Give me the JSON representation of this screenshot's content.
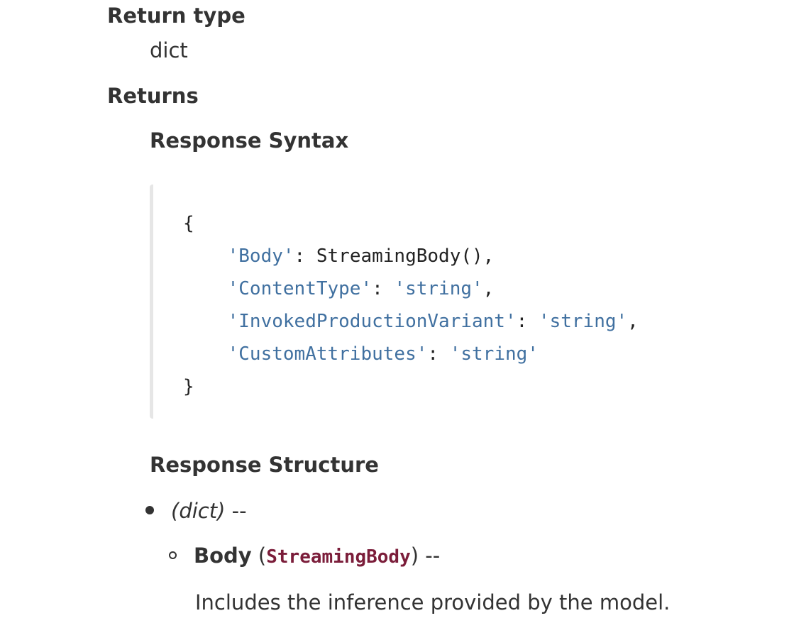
{
  "return_type": {
    "label": "Return type",
    "value": "dict"
  },
  "returns": {
    "label": "Returns",
    "syntax_heading": "Response Syntax",
    "code": {
      "open_brace": "{",
      "close_brace": "}",
      "lines": [
        {
          "key": "'Body'",
          "sep": ": ",
          "value": "StreamingBody()",
          "value_is_string": false,
          "trail": ","
        },
        {
          "key": "'ContentType'",
          "sep": ": ",
          "value": "'string'",
          "value_is_string": true,
          "trail": ","
        },
        {
          "key": "'InvokedProductionVariant'",
          "sep": ": ",
          "value": "'string'",
          "value_is_string": true,
          "trail": ","
        },
        {
          "key": "'CustomAttributes'",
          "sep": ": ",
          "value": "'string'",
          "value_is_string": true,
          "trail": ""
        }
      ]
    },
    "structure_heading": "Response Structure",
    "structure": {
      "root_type": "(dict)",
      "root_suffix": " --",
      "body": {
        "name": "Body",
        "open_paren": " (",
        "type": "StreamingBody",
        "close_paren": ")",
        "suffix": " --",
        "description": "Includes the inference provided by the model."
      }
    }
  },
  "colors": {
    "text": "#333333",
    "string_token": "#4070a0",
    "type_code": "#7b1d3a",
    "code_border": "#e6e6e6"
  }
}
